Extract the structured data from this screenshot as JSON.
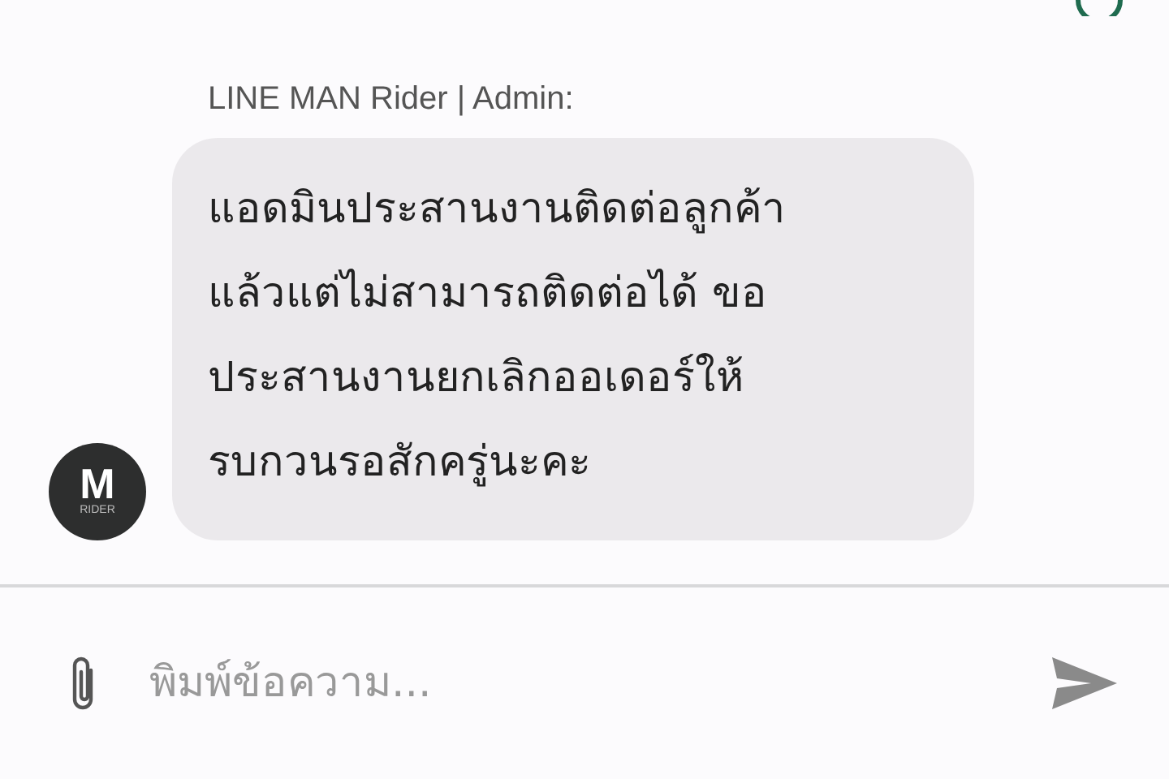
{
  "message": {
    "sender": "LINE MAN Rider | Admin:",
    "lines": [
      "แอดมินประสานงานติดต่อลูกค้า",
      "แล้วแต่ไม่สามารถติดต่อได้ ขอ",
      "ประสานงานยกเลิกออเดอร์ให้",
      "รบกวนรอสักครู่นะคะ"
    ],
    "avatar": {
      "mark": "M",
      "caption": "RIDER"
    }
  },
  "composer": {
    "placeholder": "พิมพ์ข้อความ..."
  }
}
